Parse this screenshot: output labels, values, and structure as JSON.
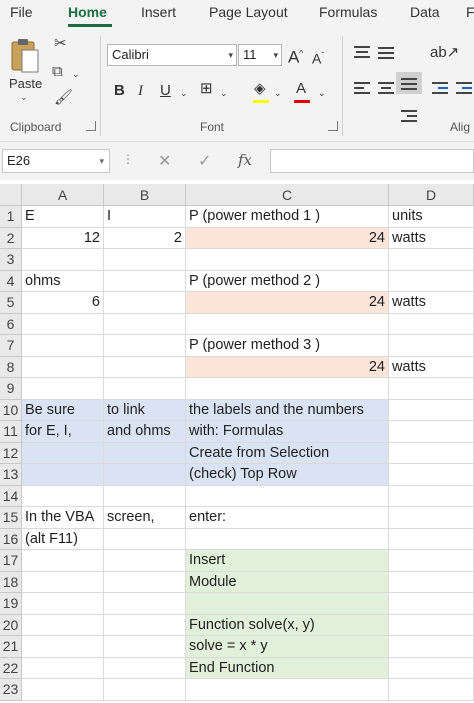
{
  "ribbon_tabs": [
    "File",
    "Home",
    "Insert",
    "Page Layout",
    "Formulas",
    "Data",
    "F"
  ],
  "clipboard": {
    "paste_label": "Paste",
    "group_label": "Clipboard"
  },
  "font": {
    "name": "Calibri",
    "size": "11",
    "group_label": "Font",
    "bold": "B",
    "italic": "I",
    "underline": "U",
    "grow": "A",
    "shrink": "A",
    "font_color": "A"
  },
  "alignment": {
    "group_label": "Alig"
  },
  "formula_bar": {
    "name_box": "E26",
    "fx": "fx",
    "cancel": "✕",
    "enter": "✓",
    "formula": ""
  },
  "colors": {
    "accent": "#1e6c41",
    "result_fill": "#fbe4d8",
    "note_fill": "#dae3f3",
    "code_fill": "#e2efda"
  },
  "columns": [
    "A",
    "B",
    "C",
    "D"
  ],
  "rows": [
    "1",
    "2",
    "3",
    "4",
    "5",
    "6",
    "7",
    "8",
    "9",
    "10",
    "11",
    "12",
    "13",
    "14",
    "15",
    "16",
    "17",
    "18",
    "19",
    "20",
    "21",
    "22",
    "23"
  ],
  "cells": {
    "A1": "E",
    "B1": "I",
    "C1": "P  (power method 1 )",
    "D1": "units",
    "A2": "12",
    "B2": "2",
    "C2": "24",
    "D2": "watts",
    "A4": "ohms",
    "C4": "P (power method 2 )",
    "A5": "6",
    "C5": "24",
    "D5": "watts",
    "C7": "P (power method 3 )",
    "C8": "24",
    "D8": "watts",
    "A10": "Be sure",
    "B10": "to link",
    "C10": "the labels and the numbers",
    "A11": "for  E,  I,",
    "B11": "and ohms",
    "C11": "with:  Formulas",
    "C12": "Create from Selection",
    "C13": "(check) Top Row",
    "A15": "In the  VBA",
    "B15": "screen,",
    "C15": "enter:",
    "A16": "(alt F11)",
    "C17": "Insert",
    "C18": "   Module",
    "C20": "Function solve(x, y)",
    "C21": "solve = x * y",
    "C22": "End Function"
  }
}
